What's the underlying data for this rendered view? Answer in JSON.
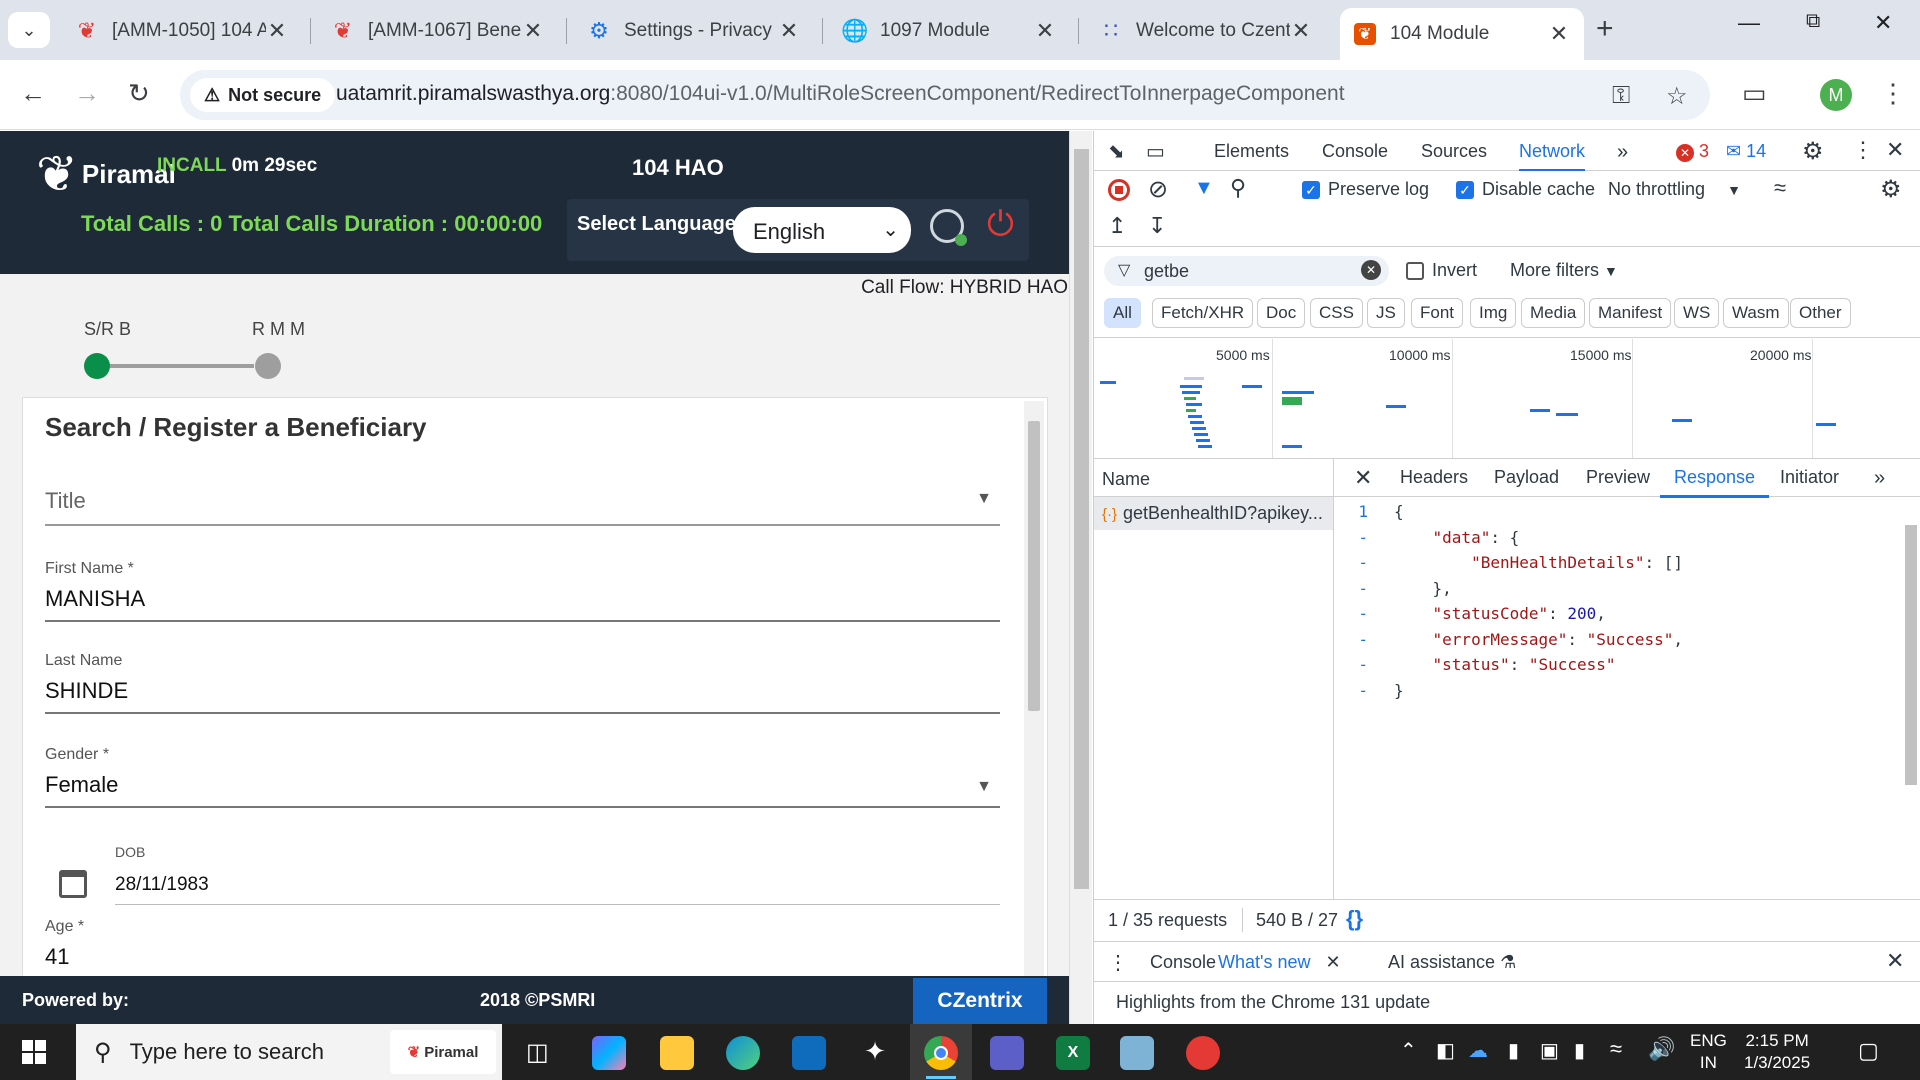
{
  "browser": {
    "tabs": [
      {
        "title": "[AMM-1050] 104 A",
        "active": false
      },
      {
        "title": "[AMM-1067] Bene",
        "active": false
      },
      {
        "title": "Settings - Privacy a",
        "active": false
      },
      {
        "title": "1097 Module",
        "active": false
      },
      {
        "title": "Welcome to Czent",
        "active": false
      },
      {
        "title": "104 Module",
        "active": true
      }
    ],
    "not_secure": "Not secure",
    "url_host": "uatamrit.piramalswasthya.org",
    "url_path": ":8080/104ui-v1.0/MultiRoleScreenComponent/RedirectToInnerpageComponent",
    "profile_initial": "M"
  },
  "app": {
    "logo_text": "Piramal",
    "incall_label": "INCALL",
    "incall_timer": "0m 29sec",
    "role_title": "104 HAO",
    "totals": "Total Calls : 0 Total Calls Duration : 00:00:00",
    "select_language_label": "Select Language:",
    "language_value": "English",
    "call_flow": "Call Flow: HYBRID HAO",
    "stepper": {
      "step1": "S/R B",
      "step2": "R M M"
    },
    "form": {
      "title": "Search / Register a Beneficiary",
      "title_placeholder": "Title",
      "first_name_label": "First Name *",
      "first_name_value": "MANISHA",
      "last_name_label": "Last Name",
      "last_name_value": "SHINDE",
      "gender_label": "Gender *",
      "gender_value": "Female",
      "dob_label": "DOB",
      "dob_value": "28/11/1983",
      "age_label": "Age *",
      "age_value": "41"
    },
    "footer": {
      "powered_by": "Powered by:",
      "copyright": "2018 ©PSMRI",
      "czentrix": "CZentrix"
    }
  },
  "devtools": {
    "tabs": [
      "Elements",
      "Console",
      "Sources",
      "Network"
    ],
    "active_tab": "Network",
    "error_count": "3",
    "message_count": "14",
    "preserve_log": "Preserve log",
    "disable_cache": "Disable cache",
    "throttling": "No throttling",
    "filter_value": "getbe",
    "invert": "Invert",
    "more_filters": "More filters",
    "filter_types": [
      "All",
      "Fetch/XHR",
      "Doc",
      "CSS",
      "JS",
      "Font",
      "Img",
      "Media",
      "Manifest",
      "WS",
      "Wasm",
      "Other"
    ],
    "timeline_ticks": [
      "5000 ms",
      "10000 ms",
      "15000 ms",
      "20000 ms"
    ],
    "name_header": "Name",
    "request_name": "getBenhealthID?apikey...",
    "detail_tabs": [
      "Headers",
      "Payload",
      "Preview",
      "Response",
      "Initiator"
    ],
    "active_detail_tab": "Response",
    "response_lines": [
      {
        "no": "1",
        "text": "{"
      },
      {
        "no": "-",
        "text": "    \"data\": {"
      },
      {
        "no": "-",
        "text": "        \"BenHealthDetails\": []"
      },
      {
        "no": "-",
        "text": "    },"
      },
      {
        "no": "-",
        "text": "    \"statusCode\": 200,"
      },
      {
        "no": "-",
        "text": "    \"errorMessage\": \"Success\","
      },
      {
        "no": "-",
        "text": "    \"status\": \"Success\""
      },
      {
        "no": "-",
        "text": "}"
      }
    ],
    "requests_summary": "1 / 35 requests",
    "transfer_summary": "540 B / 27",
    "drawer_tabs": [
      "Console",
      "What's new",
      "AI assistance"
    ],
    "drawer_text": "Highlights from the Chrome 131 update"
  },
  "taskbar": {
    "search_placeholder": "Type here to search",
    "search_badge": "Piramal",
    "lang_line1": "ENG",
    "lang_line2": "IN",
    "time": "2:15 PM",
    "date": "1/3/2025"
  }
}
